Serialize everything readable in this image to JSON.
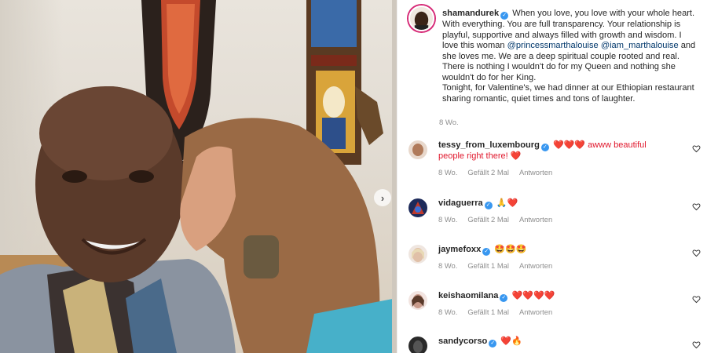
{
  "post": {
    "author": "shamandurek",
    "caption_part1": "When you love, you love with your whole heart. With everything. You are full transparency. Your relationship is playful, supportive and always filled with growth and wisdom. I love this woman ",
    "mention1": "@princessmarthalouise",
    "mention2": "@iam_marthalouise",
    "caption_part2": " and she loves me. We are a deep spiritual couple rooted and real. There is nothing I wouldn't do for my Queen and nothing she wouldn't do for her King.",
    "caption_part3": "Tonight, for Valentine's, we had dinner at our Ethiopian restaurant sharing romantic, quiet times and tons of laughter.",
    "time": "8 Wo."
  },
  "comments": [
    {
      "username": "tessy_from_luxembourg",
      "verified": true,
      "text": "❤️❤️❤️ awww beautiful people right there! ❤️",
      "time": "8 Wo.",
      "likes": "Gefällt 2 Mal",
      "reply": "Antworten",
      "avatar_color": "#b07a5a"
    },
    {
      "username": "vidaguerra",
      "verified": true,
      "text": "🙏❤️",
      "time": "8 Wo.",
      "likes": "Gefällt 2 Mal",
      "reply": "Antworten",
      "avatar_color": "#2a3a6a"
    },
    {
      "username": "jaymefoxx",
      "verified": true,
      "text": "🤩🤩🤩",
      "time": "8 Wo.",
      "likes": "Gefällt 1 Mal",
      "reply": "Antworten",
      "avatar_color": "#d9c2b0"
    },
    {
      "username": "keishaomilana",
      "verified": true,
      "text": "❤️❤️❤️❤️",
      "time": "8 Wo.",
      "likes": "Gefällt 1 Mal",
      "reply": "Antworten",
      "avatar_color": "#c99a8a"
    },
    {
      "username": "sandycorso",
      "verified": true,
      "text": "❤️🔥",
      "time": "",
      "likes": "",
      "reply": "",
      "avatar_color": "#3a3a3a"
    }
  ],
  "icons": {
    "verified": "verified-badge-icon",
    "like": "heart-outline-icon",
    "next": "chevron-right-icon"
  },
  "colors": {
    "verified": "#3897f0",
    "mention": "#00376b",
    "meta": "#8e8e8e"
  }
}
